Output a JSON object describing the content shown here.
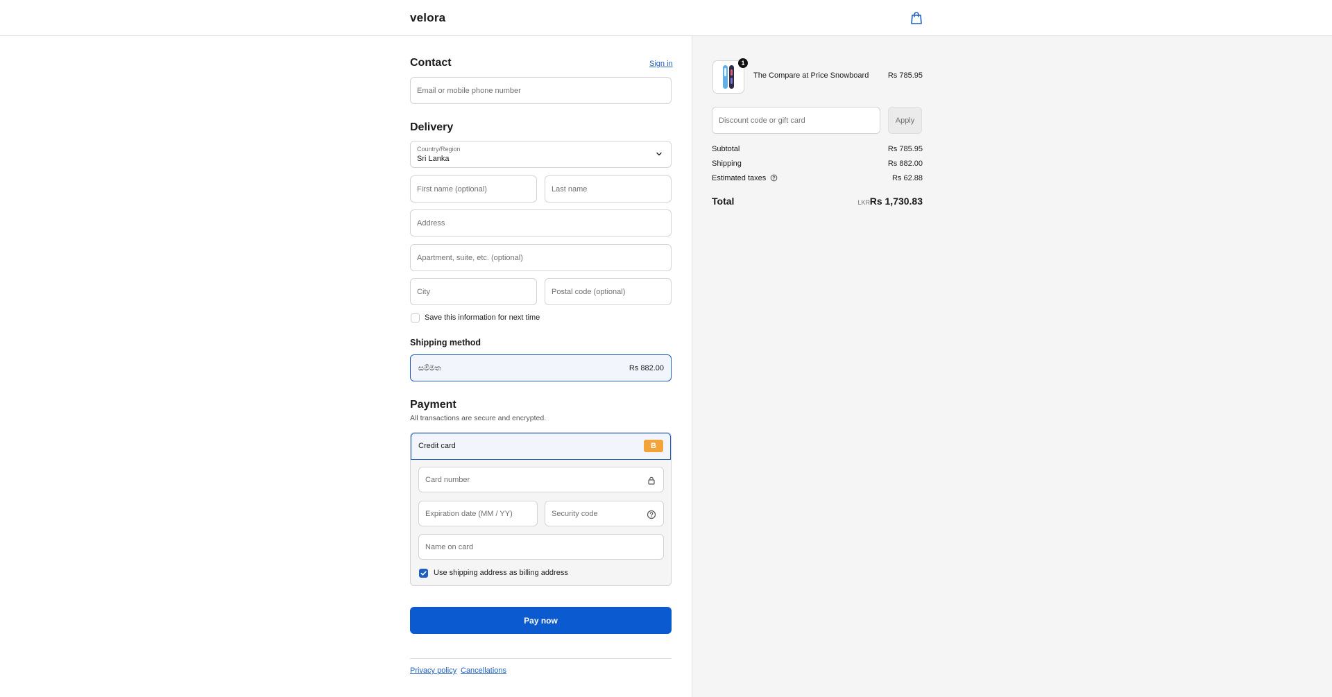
{
  "header": {
    "logo": "velora",
    "cart_icon": "shopping-bag-icon"
  },
  "contact": {
    "title": "Contact",
    "sign_in": "Sign in",
    "email_placeholder": "Email or mobile phone number"
  },
  "delivery": {
    "title": "Delivery",
    "country_label": "Country/Region",
    "country_value": "Sri Lanka",
    "first_name_placeholder": "First name (optional)",
    "last_name_placeholder": "Last name",
    "address_placeholder": "Address",
    "apartment_placeholder": "Apartment, suite, etc. (optional)",
    "city_placeholder": "City",
    "postal_placeholder": "Postal code (optional)",
    "save_info_label": "Save this information for next time"
  },
  "shipping": {
    "title": "Shipping method",
    "option_name": "සම්මත",
    "option_price": "Rs 882.00"
  },
  "payment": {
    "title": "Payment",
    "subtitle": "All transactions are secure and encrypted.",
    "method_label": "Credit card",
    "method_badge": "B",
    "card_number_placeholder": "Card number",
    "expiry_placeholder": "Expiration date (MM / YY)",
    "security_placeholder": "Security code",
    "name_placeholder": "Name on card",
    "billing_same_label": "Use shipping address as billing address",
    "billing_same_checked": true
  },
  "pay_button": "Pay now",
  "footer": {
    "privacy": "Privacy policy",
    "cancellations": "Cancellations"
  },
  "summary": {
    "product": {
      "name": "The Compare at Price Snowboard",
      "price": "Rs 785.95",
      "quantity": "1"
    },
    "discount_placeholder": "Discount code or gift card",
    "apply_label": "Apply",
    "subtotal_label": "Subtotal",
    "subtotal_value": "Rs 785.95",
    "shipping_label": "Shipping",
    "shipping_value": "Rs 882.00",
    "taxes_label": "Estimated taxes",
    "taxes_value": "Rs 62.88",
    "total_label": "Total",
    "total_currency": "LKR",
    "total_value": "Rs 1,730.83"
  },
  "colors": {
    "accent": "#1f5fbf",
    "pay_button": "#0b5ad0",
    "badge": "#f2a33a",
    "summary_bg": "#f5f5f5"
  }
}
